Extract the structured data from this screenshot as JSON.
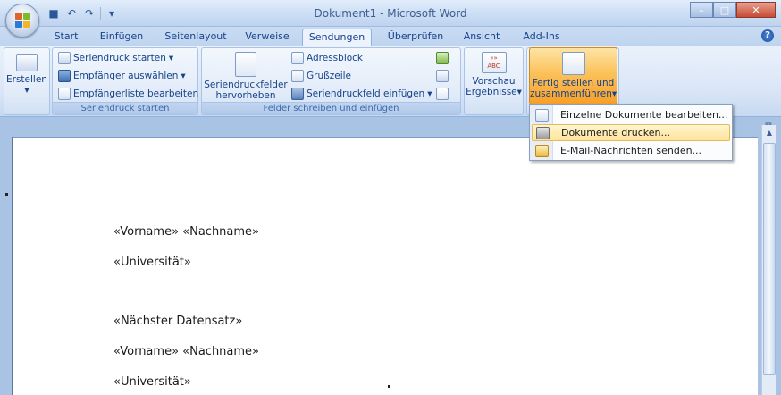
{
  "window": {
    "title": "Dokument1 - Microsoft Word",
    "controls": {
      "minimize": "–",
      "maximize": "□",
      "close": "✕"
    }
  },
  "quick_access": [
    {
      "icon": "save-icon",
      "glyph": "■"
    },
    {
      "icon": "undo-icon",
      "glyph": "↶"
    },
    {
      "icon": "redo-icon",
      "glyph": "↷"
    },
    {
      "icon": "customize-icon",
      "glyph": "▾"
    }
  ],
  "tabs": [
    {
      "label": "Start"
    },
    {
      "label": "Einfügen"
    },
    {
      "label": "Seitenlayout"
    },
    {
      "label": "Verweise"
    },
    {
      "label": "Sendungen",
      "active": true
    },
    {
      "label": "Überprüfen"
    },
    {
      "label": "Ansicht"
    },
    {
      "label": "Add-Ins"
    }
  ],
  "help_glyph": "?",
  "ribbon": {
    "erstellen": {
      "label": "Erstellen",
      "caret": "▾"
    },
    "seriendruck_starten": {
      "group_label": "Seriendruck starten",
      "buttons": [
        {
          "label": "Seriendruck starten",
          "caret": "▾"
        },
        {
          "label": "Empfänger auswählen",
          "caret": "▾"
        },
        {
          "label": "Empfängerliste bearbeiten"
        }
      ]
    },
    "felder": {
      "group_label": "Felder schreiben und einfügen",
      "highlight_line1": "Seriendruckfelder",
      "highlight_line2": "hervorheben",
      "buttons": [
        {
          "label": "Adressblock"
        },
        {
          "label": "Grußzeile"
        },
        {
          "label": "Seriendruckfeld einfügen",
          "caret": "▾"
        }
      ]
    },
    "vorschau": {
      "line1": "Vorschau",
      "line2": "Ergebnisse",
      "caret": "▾",
      "icon_text": "«»\nABC"
    },
    "fertig": {
      "line1": "Fertig stellen und",
      "line2": "zusammenführen",
      "caret": "▾"
    }
  },
  "menu": {
    "items": [
      {
        "label": "Einzelne Dokumente bearbeiten...",
        "highlighted": false
      },
      {
        "label": "Dokumente drucken...",
        "highlighted": true
      },
      {
        "label": "E-Mail-Nachrichten senden...",
        "highlighted": false
      }
    ]
  },
  "document": {
    "lines": [
      "«Vorname» «Nachname»",
      "«Universität»",
      "«Nächster Datensatz»",
      "«Vorname» «Nachname»",
      "«Universität»"
    ]
  },
  "colors": {
    "accent": "#15428b",
    "ribbon_bg": "#dbe7f7",
    "finish_highlight": "#fbc25a",
    "menu_highlight": "#ffe39b"
  }
}
